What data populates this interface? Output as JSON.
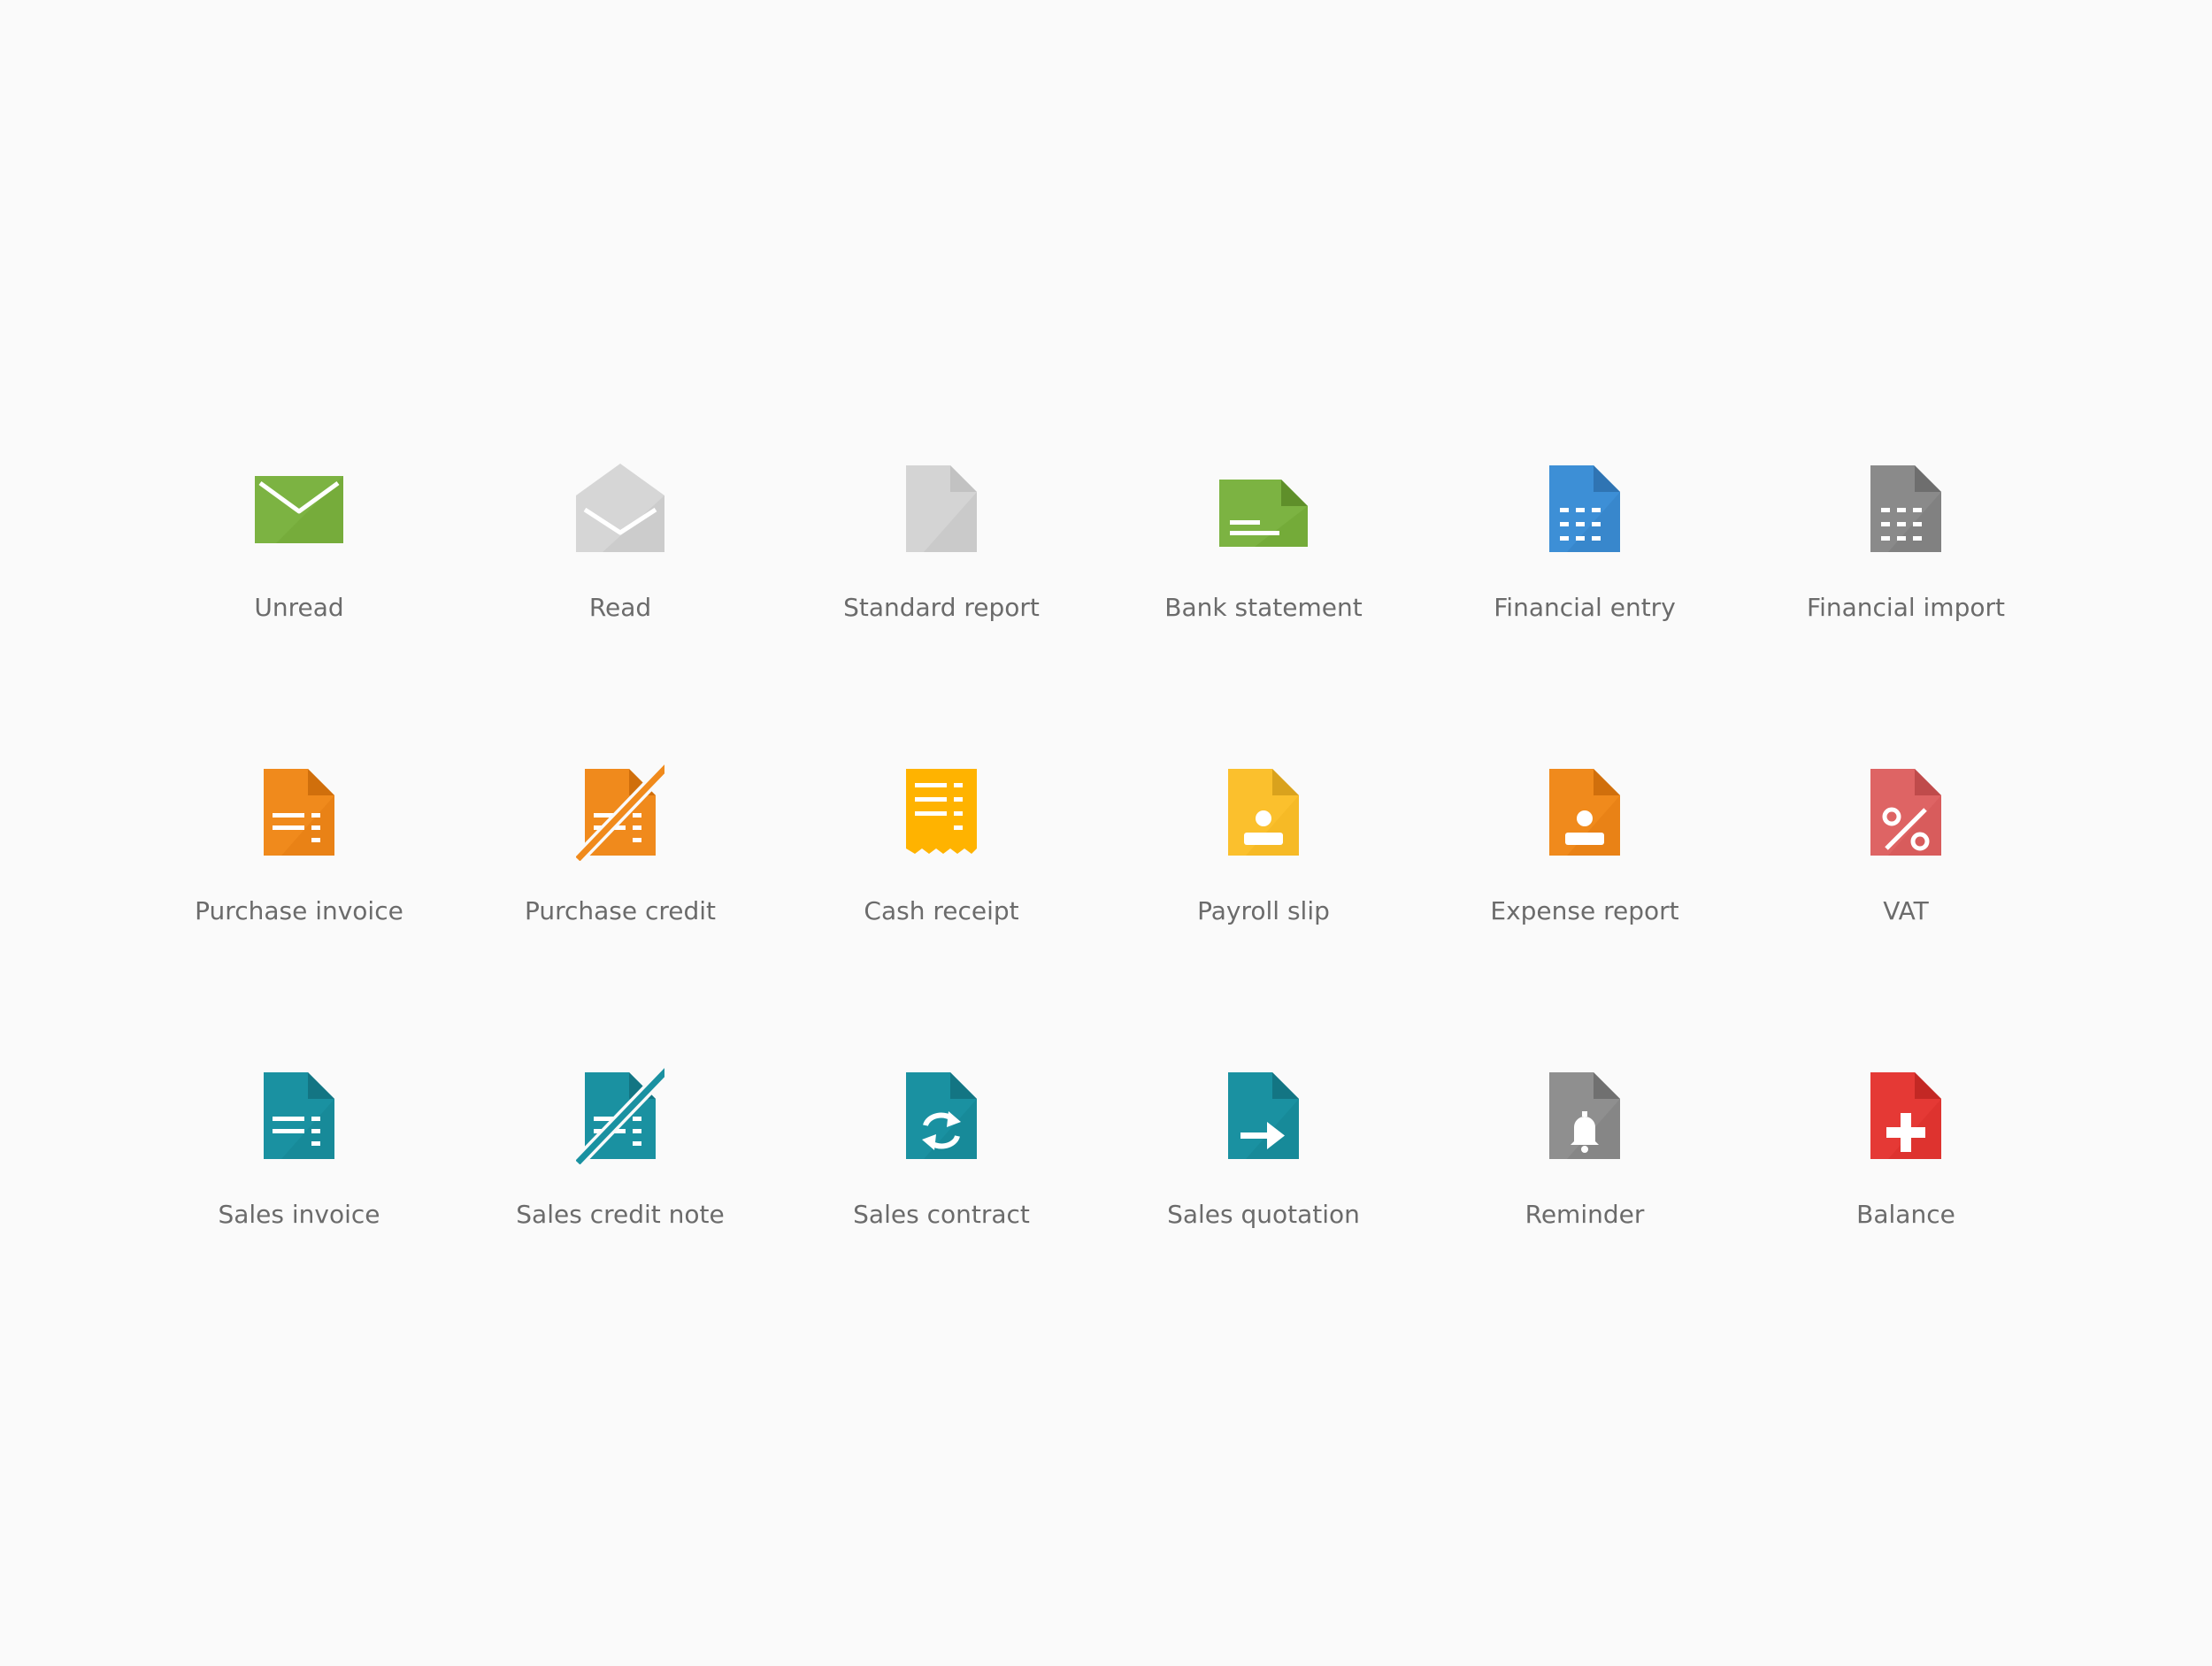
{
  "rows": [
    [
      {
        "label": "Unread",
        "icon": "envelope-closed-icon",
        "color": "#7cb342"
      },
      {
        "label": "Read",
        "icon": "envelope-open-icon",
        "color": "#cfcfcf"
      },
      {
        "label": "Standard report",
        "icon": "blank-document-icon",
        "color": "#cfcfcf"
      },
      {
        "label": "Bank statement",
        "icon": "bank-statement-icon",
        "color": "#7cb342"
      },
      {
        "label": "Financial entry",
        "icon": "ledger-grid-icon",
        "color": "#3d8fd6"
      },
      {
        "label": "Financial import",
        "icon": "ledger-grid-icon",
        "color": "#8a8a8a"
      }
    ],
    [
      {
        "label": "Purchase invoice",
        "icon": "invoice-lines-icon",
        "color": "#f08a1c"
      },
      {
        "label": "Purchase credit",
        "icon": "invoice-struck-icon",
        "color": "#f08a1c"
      },
      {
        "label": "Cash receipt",
        "icon": "receipt-icon",
        "color": "#ffb300"
      },
      {
        "label": "Payroll slip",
        "icon": "person-document-icon",
        "color": "#fbc02d"
      },
      {
        "label": "Expense report",
        "icon": "person-document-icon",
        "color": "#f08a1c"
      },
      {
        "label": "VAT",
        "icon": "percent-document-icon",
        "color": "#de6464"
      }
    ],
    [
      {
        "label": "Sales invoice",
        "icon": "invoice-lines-icon",
        "color": "#1a91a1"
      },
      {
        "label": "Sales credit note",
        "icon": "invoice-struck-icon",
        "color": "#1a91a1"
      },
      {
        "label": "Sales contract",
        "icon": "repeat-document-icon",
        "color": "#1a91a1"
      },
      {
        "label": "Sales quotation",
        "icon": "arrow-document-icon",
        "color": "#1a91a1"
      },
      {
        "label": "Reminder",
        "icon": "bell-document-icon",
        "color": "#8a8a8a"
      },
      {
        "label": "Balance",
        "icon": "plus-document-icon",
        "color": "#e53935"
      }
    ]
  ]
}
